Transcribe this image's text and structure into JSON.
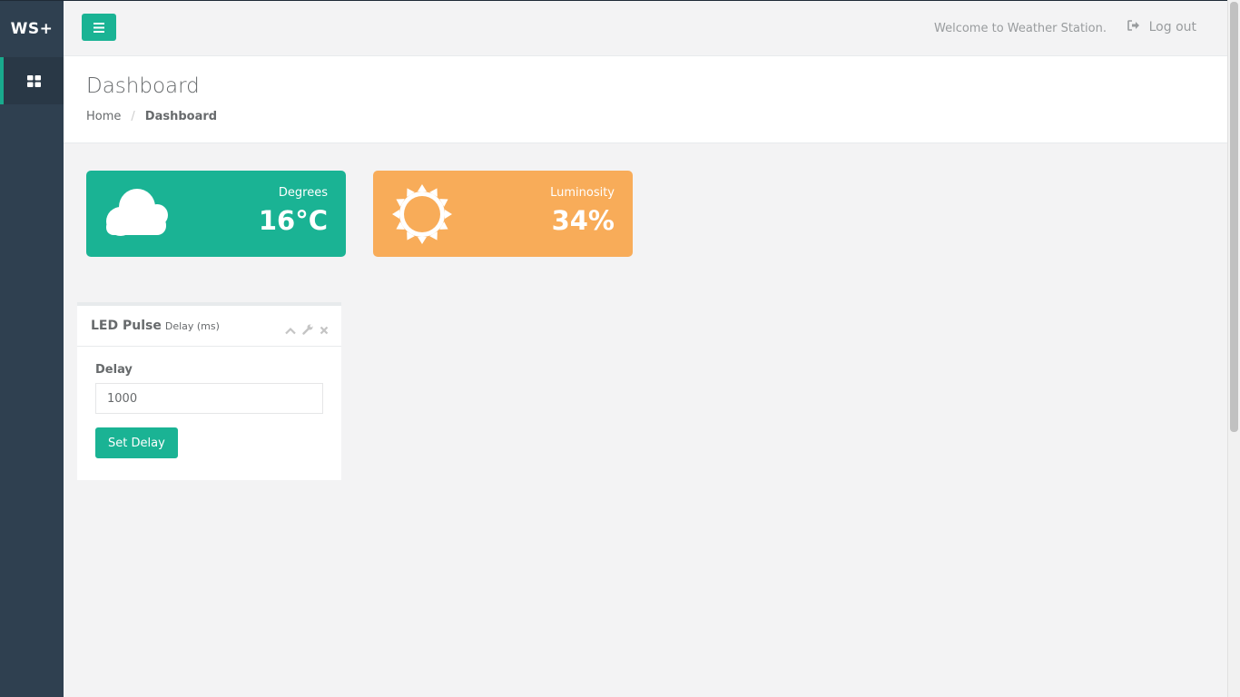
{
  "brand": "WS+",
  "sidebar": {
    "items": [
      {
        "icon": "dashboard-grid-icon",
        "active": true
      }
    ]
  },
  "topbar": {
    "menu_icon": "hamburger-icon",
    "welcome": "Welcome to Weather Station.",
    "logout_label": "Log out",
    "logout_icon": "sign-out-icon"
  },
  "page": {
    "title": "Dashboard",
    "breadcrumb": {
      "home": "Home",
      "separator": "/",
      "current": "Dashboard"
    }
  },
  "widgets": [
    {
      "label": "Degrees",
      "value": "16°C",
      "icon": "cloud-icon",
      "color": "#1ab394"
    },
    {
      "label": "Luminosity",
      "value": "34%",
      "icon": "sun-icon",
      "color": "#f8ac59"
    }
  ],
  "panel": {
    "title": "LED Pulse",
    "subtitle": "Delay (ms)",
    "tools": [
      "chevron-up-icon",
      "wrench-icon",
      "close-icon"
    ],
    "field_label": "Delay",
    "field_value": "1000",
    "button_label": "Set Delay"
  },
  "colors": {
    "primary": "#1ab394",
    "warning": "#f8ac59",
    "sidebar": "#2f4050"
  }
}
